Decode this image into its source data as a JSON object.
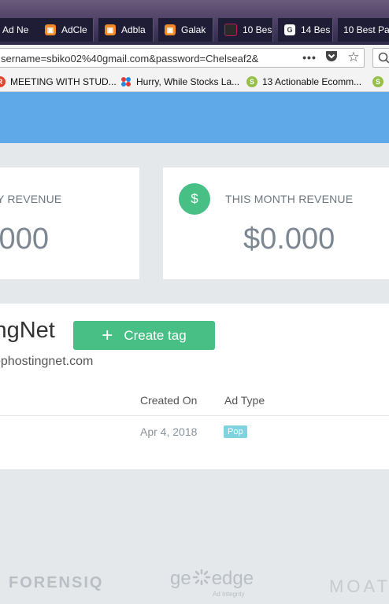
{
  "browser": {
    "tabs": [
      {
        "label": "Ad Ne",
        "icon": "none"
      },
      {
        "label": "AdCle",
        "icon": "adclear-icon"
      },
      {
        "label": "Adbla",
        "icon": "adblade-icon"
      },
      {
        "label": "Galak",
        "icon": "galaksion-icon"
      },
      {
        "label": "10 Bes",
        "icon": "site-icon"
      },
      {
        "label": "14 Bes",
        "icon": "g-icon"
      },
      {
        "label": "10 Best Pa",
        "icon": "none"
      }
    ],
    "url": "sername=sbiko02%40gmail.com&password=Chelseaf2&",
    "bookmarks": [
      {
        "label": "MEETING WITH STUD...",
        "icon": "r-icon"
      },
      {
        "label": "Hurry, While Stocks La...",
        "icon": "s-icon"
      },
      {
        "label": "13 Actionable Ecomm...",
        "icon": "shopify-icon"
      }
    ]
  },
  "dashboard": {
    "cards": [
      {
        "label": "Y REVENUE",
        "value": ".000"
      },
      {
        "label": "THIS MONTH REVENUE",
        "value": "$0.000",
        "icon": "$"
      }
    ],
    "site": {
      "name": "ingNet",
      "url": "ophostingnet.com",
      "create_tag_label": "Create tag"
    },
    "table": {
      "headers": [
        "Created On",
        "Ad Type"
      ],
      "rows": [
        {
          "created_on": "Apr 4, 2018",
          "ad_type": "Pop"
        }
      ]
    },
    "footer_logos": [
      "FORENSIQ",
      "ge",
      "edge",
      "Ad Integrity",
      "MOAT"
    ]
  },
  "colors": {
    "header_blue": "#5fa9e8",
    "accent_green": "#48bf84",
    "badge_cyan": "#7ed3df",
    "page_bg": "#e4e8eb"
  }
}
